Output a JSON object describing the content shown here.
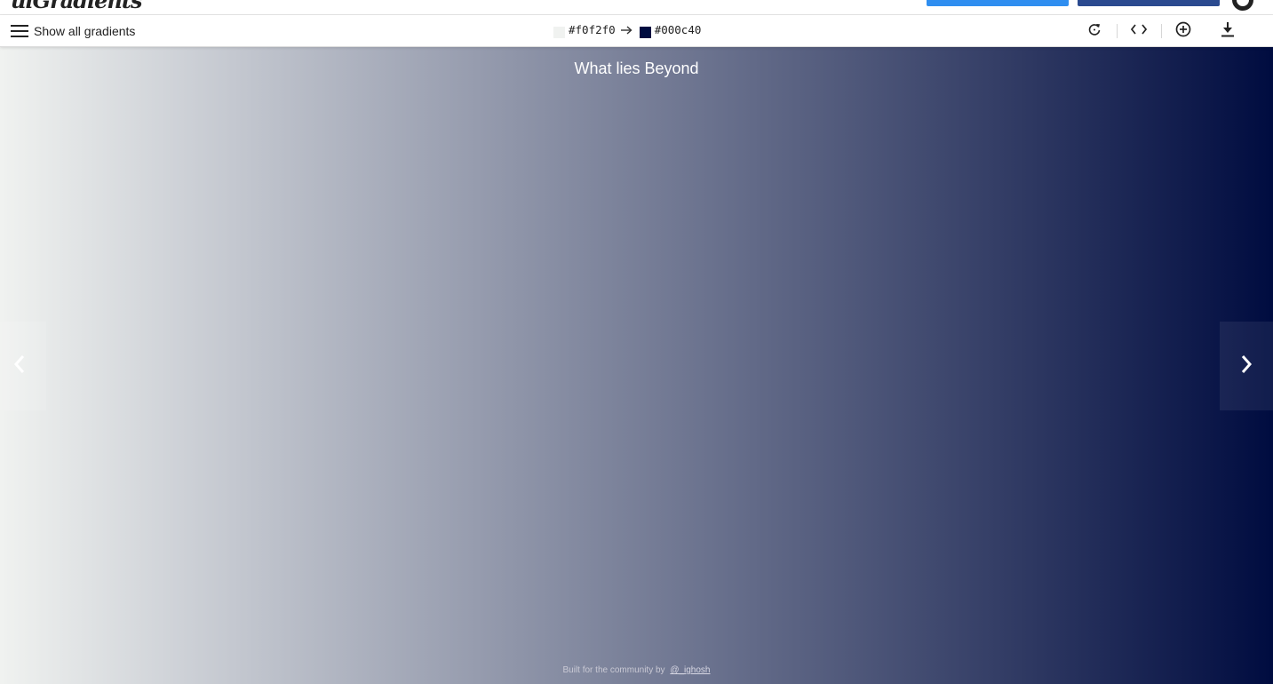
{
  "header": {
    "logo_text": "uiGradients",
    "primary_button_label": "",
    "secondary_button_label": "",
    "github_icon": "github-icon"
  },
  "toolbar": {
    "menu_icon": "hamburger-menu-icon",
    "menu_label": "Show all gradients",
    "colors": {
      "from_hex": "#f0f2f0",
      "to_hex": "#000c40"
    },
    "arrow_icon": "arrow-right-icon",
    "actions": [
      {
        "name": "rotate-icon"
      },
      {
        "name": "code-icon"
      },
      {
        "name": "add-circle-icon"
      },
      {
        "name": "download-icon"
      }
    ]
  },
  "gradient": {
    "name": "What lies Beyond",
    "direction": "to right",
    "start_color": "#f0f2f0",
    "end_color": "#000c40"
  },
  "navigation": {
    "prev_icon": "chevron-left-icon",
    "next_icon": "chevron-right-icon"
  },
  "footer": {
    "credit_prefix": "Built for the community by",
    "credit_link": "@_ighosh"
  }
}
